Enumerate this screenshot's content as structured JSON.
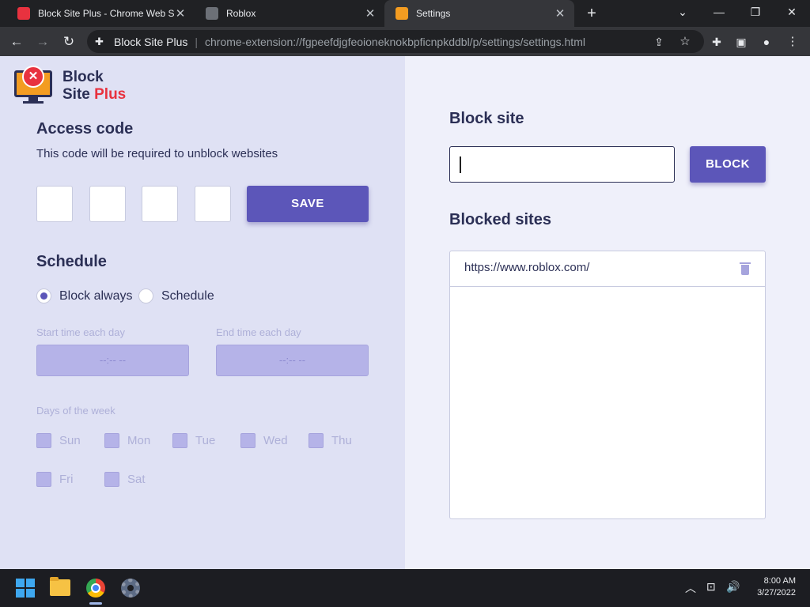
{
  "browser": {
    "tabs": [
      {
        "label": "Block Site Plus - Chrome Web Sto",
        "favicon_color": "#e8323f"
      },
      {
        "label": "Roblox",
        "favicon_color": "#9aa0a6"
      },
      {
        "label": "Settings",
        "favicon_color": "#f39c21"
      }
    ],
    "omnibox": {
      "site_name": "Block Site Plus",
      "url": "chrome-extension://fgpeefdjgfeoioneknokbpficnpkddbl/p/settings/settings.html"
    }
  },
  "logo": {
    "line1": "Block",
    "line2a": "Site ",
    "line2b": "Plus"
  },
  "access_code": {
    "title": "Access code",
    "description": "This code will be required to unblock websites",
    "save_label": "SAVE"
  },
  "schedule": {
    "title": "Schedule",
    "option_always": "Block always",
    "option_schedule": "Schedule",
    "selected": "Block always",
    "start_label": "Start time each day",
    "end_label": "End time each day",
    "start_value": "--:-- --",
    "end_value": "--:-- --",
    "days_label": "Days of the week",
    "days": [
      "Sun",
      "Mon",
      "Tue",
      "Wed",
      "Thu",
      "Fri",
      "Sat"
    ]
  },
  "block_site": {
    "title": "Block site",
    "input_value": "",
    "button_label": "BLOCK"
  },
  "blocked_sites": {
    "title": "Blocked sites",
    "items": [
      "https://www.roblox.com/"
    ]
  },
  "taskbar": {
    "time": "8:00 AM",
    "date": "3/27/2022"
  },
  "colors": {
    "accent": "#5c56b9",
    "navy": "#2b2f55",
    "danger": "#e8323f"
  }
}
